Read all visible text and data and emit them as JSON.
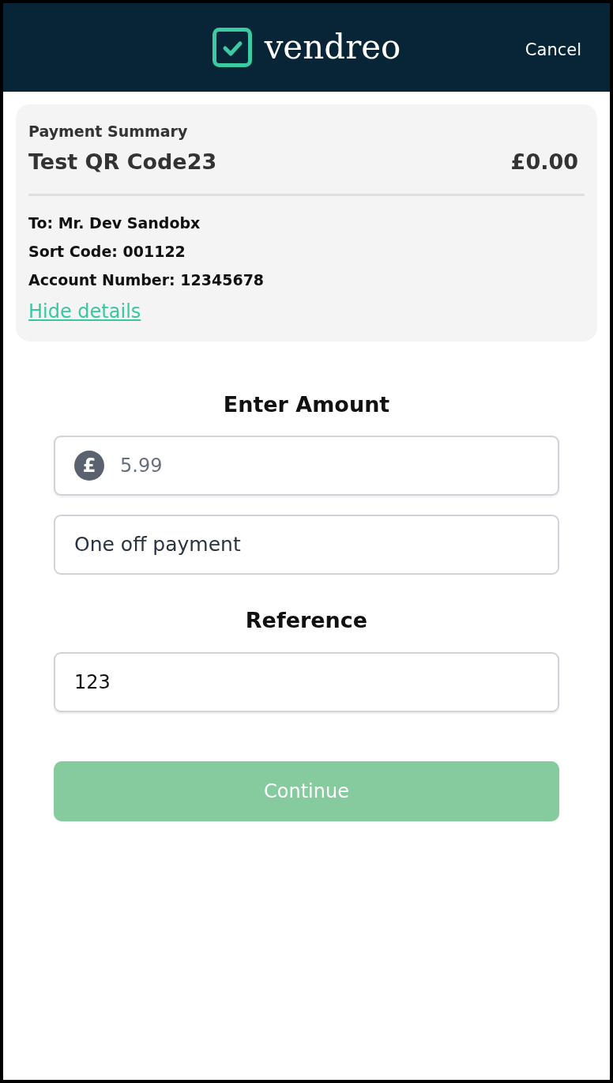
{
  "header": {
    "logo_text": "vendreo",
    "cancel": "Cancel"
  },
  "summary": {
    "heading": "Payment Summary",
    "title": "Test QR Code23",
    "amount": "£0.00",
    "details": [
      "To: Mr. Dev Sandobx",
      "Sort Code: 001122",
      "Account Number: 12345678"
    ],
    "toggle": "Hide details"
  },
  "amount_section": {
    "heading": "Enter Amount",
    "currency_symbol": "£",
    "placeholder": "5.99"
  },
  "payment_type": {
    "value": "One off payment"
  },
  "reference_section": {
    "heading": "Reference",
    "value": "123"
  },
  "continue_button": {
    "label": "Continue",
    "disabled": true
  }
}
